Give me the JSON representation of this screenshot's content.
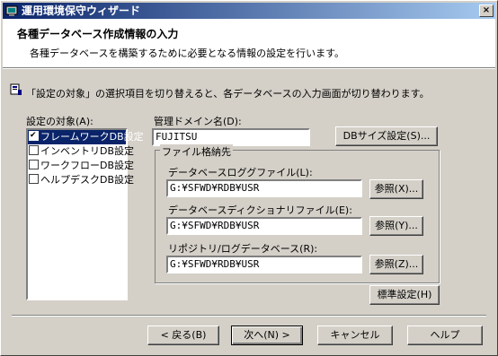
{
  "window": {
    "title": "運用環境保守ウィザード",
    "close_label": "×"
  },
  "header": {
    "title": "各種データベース作成情報の入力",
    "subtitle": "各種データベースを構築するために必要となる情報の設定を行います。"
  },
  "info_text": "「設定の対象」の選択項目を切り替えると、各データベースの入力画面が切り替わります。",
  "target_list": {
    "label": "設定の対象(A):",
    "items": [
      {
        "label": "フレームワークDB設定",
        "checked": true,
        "selected": true
      },
      {
        "label": "インベントリDB設定",
        "checked": false,
        "selected": false
      },
      {
        "label": "ワークフローDB設定",
        "checked": false,
        "selected": false
      },
      {
        "label": "ヘルプデスクDB設定",
        "checked": false,
        "selected": false
      }
    ]
  },
  "domain": {
    "label": "管理ドメイン名(D):",
    "value": "FUJITSU"
  },
  "db_size_button": "DBサイズ設定(S)...",
  "file_location": {
    "group_label": "ファイル格納先",
    "log_file": {
      "label": "データベースロググファイル(L):",
      "value": "G:¥SFWD¥RDB¥USR",
      "browse": "参照(X)..."
    },
    "dict_file": {
      "label": "データベースディクショナリファイル(E):",
      "value": "G:¥SFWD¥RDB¥USR",
      "browse": "参照(Y)..."
    },
    "repo_log": {
      "label": "リポジトリ/ログデータベース(R):",
      "value": "G:¥SFWD¥RDB¥USR",
      "browse": "参照(Z)..."
    }
  },
  "standard_button": "標準設定(H)",
  "footer": {
    "back": "< 戻る(B)",
    "next": "次へ(N) >",
    "cancel": "キャンセル",
    "help": "ヘルプ"
  }
}
